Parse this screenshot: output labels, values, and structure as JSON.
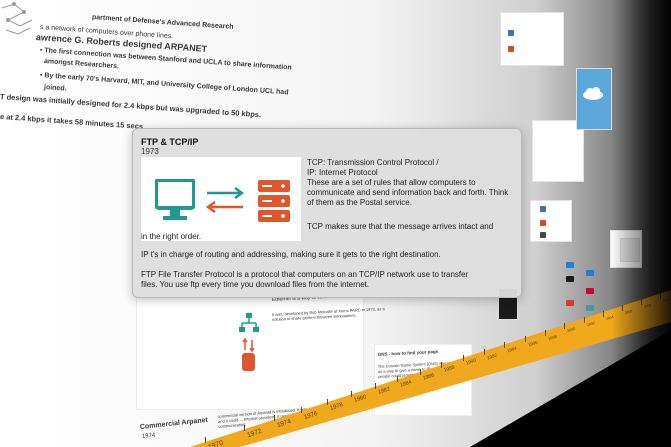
{
  "popup": {
    "title": "FTP & TCP/IP",
    "year": "1973",
    "tcp_line1": "TCP: Transmission Control Protocol /",
    "tcp_line2": "IP: Internet Protocol",
    "tcp_desc": "These are a set of rules that allow computers to communicate and send information back and forth. Think of them as the Postal service.",
    "tcp_makes_sure": "TCP makes sure that the message arrives intact and",
    "tcp_makes_sure_2": "in the right order.",
    "ip_desc": "IP t's in charge of routing and addressing, making sure it gets to the right destination.",
    "ftp_desc_1": "FTP File Transfer Protocol is a protocol that computers on an TCP/IP network use to transfer",
    "ftp_desc_2": "files. You use ftp every time you download files from the internet."
  },
  "background": {
    "line1": "partment of Defense's Advanced Research",
    "line2": "s a network of computers over phone lines.",
    "line3": "awrence G. Roberts designed ARPANET",
    "line4": "• The first connection was between Stanford and UCLA to share information",
    "line5": "amongst Researchers.",
    "line6": "• By the early 70's Harvard, MIT, and University College of London UCL had",
    "line7": "joined.",
    "line8": "T design was initially designed for 2.4 kbps but was upgraded to 50 kbps.",
    "line9": "e at 2.4 kbps it takes 58 minutes 15 secs",
    "ethernet_title": "Ethernet is a way to connect ...",
    "ethernet_desc": "It was, developed by Bob Metcalfe at Xerox PARC in 1973, as a solution to share printers between workstations.",
    "commercial_title": "Commercial Arpanet",
    "commercial_year": "1974",
    "commercial_desc": "commercial version of Arpanet is introduced. It was called Telenet and it could ... Internet providers. It used packet switched communication.",
    "dns_title": "DNS - how to find your page",
    "dns_desc": "The Domain Name System (DNS) was invented as a way to give a name to IP addresses that people could remember and use."
  },
  "timeline": {
    "years": [
      "1970",
      "1972",
      "1974",
      "1976",
      "1978",
      "1980",
      "1982",
      "1984",
      "1986",
      "1988",
      "1990",
      "1992",
      "1994",
      "1996",
      "1998",
      "2000",
      "2002",
      "2004",
      "2006",
      "2008",
      "2010"
    ]
  },
  "colors": {
    "timeline_bar": "#f0a91c",
    "teal": "#1f9b8e",
    "orange": "#e0562c"
  }
}
